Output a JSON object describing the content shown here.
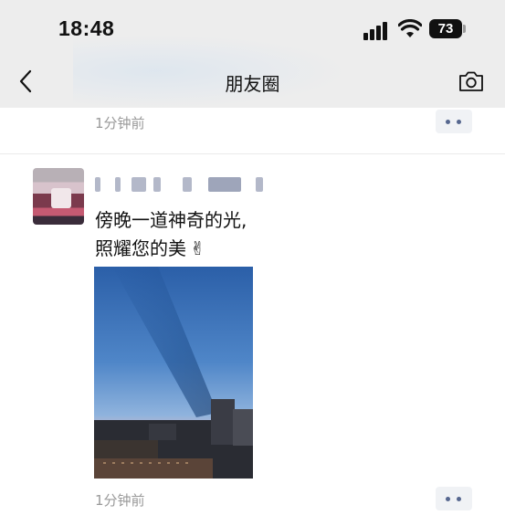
{
  "status_bar": {
    "time": "18:48",
    "battery": "73"
  },
  "nav": {
    "title": "朋友圈"
  },
  "prev_post": {
    "time": "1分钟前"
  },
  "post": {
    "text_line1": "傍晚一道神奇的光,",
    "text_line2": "照耀您的美",
    "emoji": "✌",
    "time": "1分钟前"
  },
  "icons": {
    "back": "chevron-left-icon",
    "camera": "camera-icon",
    "more": "more-dots-icon",
    "signal": "cellular-signal-icon",
    "wifi": "wifi-icon",
    "battery": "battery-icon"
  },
  "colors": {
    "header_bg": "#ededed",
    "link_blue": "#56678f",
    "timestamp_gray": "#999999"
  }
}
